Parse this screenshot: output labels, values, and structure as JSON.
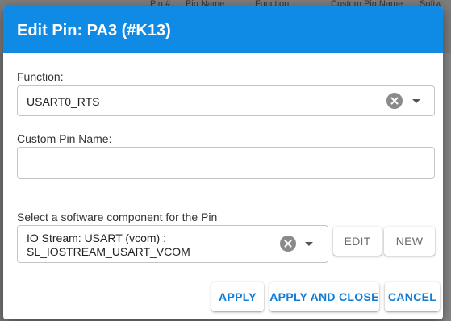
{
  "background_table": {
    "headers": [
      "Pin #",
      "Pin Name",
      "Function",
      "Custom Pin Name",
      "Softw"
    ]
  },
  "dialog": {
    "title": "Edit Pin: PA3 (#K13)",
    "function": {
      "label": "Function:",
      "value": "USART0_RTS"
    },
    "custom_pin_name": {
      "label": "Custom Pin Name:",
      "value": "",
      "placeholder": ""
    },
    "software_component": {
      "label": "Select a software component for the Pin",
      "value_line1": "IO Stream: USART (vcom) :",
      "value_line2": "SL_IOSTREAM_USART_VCOM",
      "edit_label": "EDIT",
      "new_label": "NEW"
    },
    "actions": {
      "apply_label": "APPLY",
      "apply_close_label": "APPLY AND CLOSE",
      "cancel_label": "CANCEL"
    }
  },
  "colors": {
    "header": "#0f8be6",
    "primary_text": "#0f7dd6"
  }
}
